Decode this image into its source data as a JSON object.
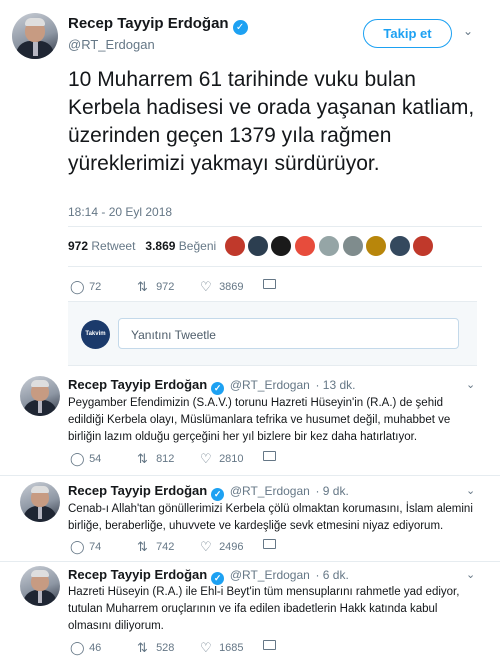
{
  "main_tweet": {
    "name": "Recep Tayyip Erdoğan",
    "handle": "@RT_Erdogan",
    "follow_label": "Takip et",
    "text": "10 Muharrem 61 tarihinde vuku bulan Kerbela hadisesi ve orada yaşanan katliam, üzerinden geçen 1379 yıla rağmen yüreklerimizi yakmayı sürdürüyor.",
    "timestamp": "18:14 - 20 Eyl 2018",
    "retweet_count": "972",
    "retweet_label": "Retweet",
    "like_count": "3.869",
    "like_label": "Beğeni",
    "actions": {
      "replies": "72",
      "retweets": "972",
      "likes": "3869"
    }
  },
  "reply_box": {
    "logo_text": "Takvim",
    "placeholder": "Yanıtını Tweetle"
  },
  "thread": [
    {
      "name": "Recep Tayyip Erdoğan",
      "handle": "@RT_Erdogan",
      "time": "· 13 dk.",
      "text": "Peygamber Efendimizin (S.A.V.) torunu Hazreti Hüseyin'in (R.A.) de şehid edildiği Kerbela olayı, Müslümanlara tefrika ve husumet değil, muhabbet ve birliğin lazım olduğu gerçeğini her yıl bizlere bir kez daha hatırlatıyor.",
      "replies": "54",
      "retweets": "812",
      "likes": "2810"
    },
    {
      "name": "Recep Tayyip Erdoğan",
      "handle": "@RT_Erdogan",
      "time": "· 9 dk.",
      "text": "Cenab-ı Allah'tan gönüllerimizi Kerbela çölü olmaktan korumasını, İslam alemini birliğe, beraberliğe, uhuvvete ve kardeşliğe sevk etmesini niyaz ediyorum.",
      "replies": "74",
      "retweets": "742",
      "likes": "2496"
    },
    {
      "name": "Recep Tayyip Erdoğan",
      "handle": "@RT_Erdogan",
      "time": "· 6 dk.",
      "text": "Hazreti Hüseyin (R.A.) ile Ehl-i Beyt'in tüm mensuplarını rahmetle yad ediyor, tutulan Muharrem oruçlarının ve ifa edilen ibadetlerin Hakk katında kabul olmasını diliyorum.",
      "replies": "46",
      "retweets": "528",
      "likes": "1685"
    }
  ],
  "icons": {
    "verified": "verified-badge-icon",
    "reply": "reply-icon",
    "retweet": "retweet-icon",
    "like": "heart-icon",
    "dm": "envelope-icon",
    "more": "chevron-down-icon"
  },
  "colors": {
    "accent": "#1da1f2",
    "muted": "#657786",
    "text": "#14171a"
  },
  "glyphs": {
    "check": "✓",
    "chevron": "⌄",
    "reply": "◯",
    "retweet": "⇅",
    "heart": "♡"
  }
}
